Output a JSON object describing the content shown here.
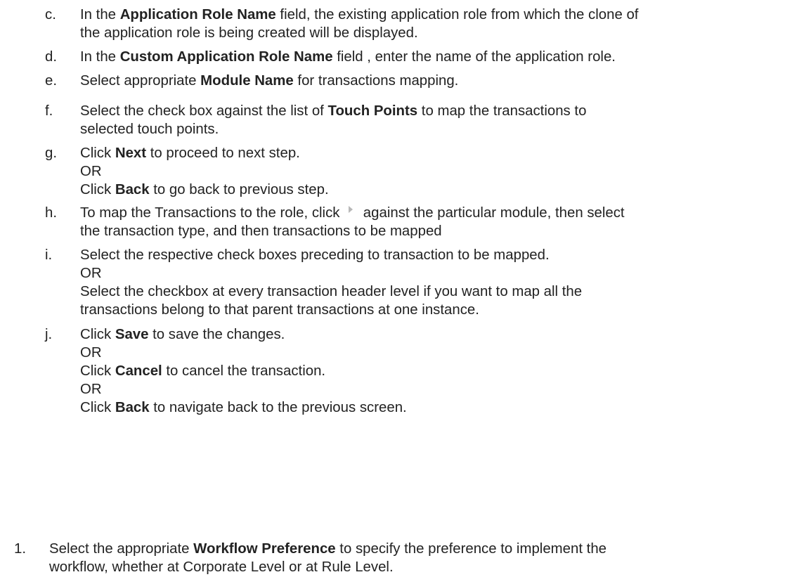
{
  "steps": [
    {
      "marker": "c.",
      "lines": [
        [
          {
            "t": "In the "
          },
          {
            "b": "Application Role Name"
          },
          {
            "t": " field, the existing application role from which the clone of"
          }
        ],
        [
          {
            "t": "the application role is being created will be displayed."
          }
        ]
      ]
    },
    {
      "marker": "d.",
      "lines": [
        [
          {
            "t": "In the "
          },
          {
            "b": "Custom Application Role Name"
          },
          {
            "t": " field , enter the name of the application role."
          }
        ]
      ]
    },
    {
      "marker": "e.",
      "lines": [
        [
          {
            "t": "Select appropriate "
          },
          {
            "b": "Module Name"
          },
          {
            "t": " for transactions mapping."
          }
        ]
      ]
    },
    {
      "marker": "f.",
      "lines": [
        [
          {
            "t": "Select the check box against the list of "
          },
          {
            "b": "Touch Points"
          },
          {
            "t": " to map the transactions to"
          }
        ],
        [
          {
            "t": "selected touch points."
          }
        ]
      ]
    },
    {
      "marker": "g.",
      "lines": [
        [
          {
            "t": "Click "
          },
          {
            "b": "Next"
          },
          {
            "t": " to proceed to next step."
          }
        ],
        [
          {
            "t": "OR"
          }
        ],
        [
          {
            "t": "Click "
          },
          {
            "b": "Back"
          },
          {
            "t": " to go back to previous step."
          }
        ]
      ]
    },
    {
      "marker": "h.",
      "lines": [
        [
          {
            "t": "To map the Transactions to the role, click "
          },
          {
            "icon": "expand-arrow-icon"
          },
          {
            "t": " against the particular module, then select"
          }
        ],
        [
          {
            "t": "the transaction type, and then transactions to be mapped"
          }
        ]
      ]
    },
    {
      "marker": "i.",
      "lines": [
        [
          {
            "t": "Select the respective check boxes preceding to transaction to be mapped."
          }
        ],
        [
          {
            "t": "OR"
          }
        ],
        [
          {
            "t": "Select the checkbox at every transaction header level if you want to map all the"
          }
        ],
        [
          {
            "t": "transactions belong to that parent transactions at one instance."
          }
        ]
      ]
    },
    {
      "marker": "j.",
      "lines": [
        [
          {
            "t": "Click "
          },
          {
            "b": "Save"
          },
          {
            "t": " to save the changes."
          }
        ],
        [
          {
            "t": "OR"
          }
        ],
        [
          {
            "t": "Click "
          },
          {
            "b": "Cancel"
          },
          {
            "t": " to cancel the transaction."
          }
        ],
        [
          {
            "t": "OR"
          }
        ],
        [
          {
            "t": "Click "
          },
          {
            "b": "Back"
          },
          {
            "t": " to navigate back to the previous screen."
          }
        ]
      ]
    }
  ],
  "numbered_step": {
    "marker": "1.",
    "lines": [
      [
        {
          "t": "Select the appropriate "
        },
        {
          "b": "Workflow Preference"
        },
        {
          "t": " to specify the preference to implement the"
        }
      ],
      [
        {
          "t": "workflow, whether at Corporate Level or at Rule Level."
        }
      ]
    ]
  }
}
